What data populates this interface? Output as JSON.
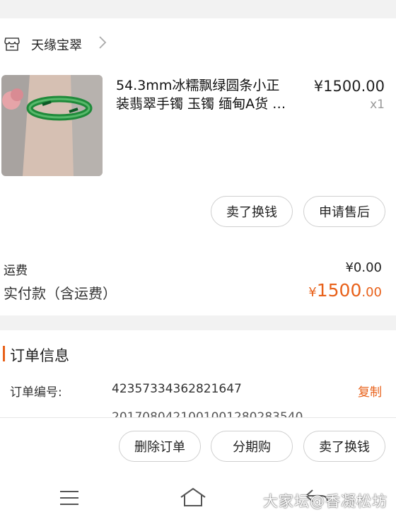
{
  "shop": {
    "name": "天缘宝翠",
    "store_icon": "store-icon",
    "chevron_icon": "chevron-right-icon"
  },
  "product": {
    "title_line1": "54.3mm冰糯飘绿圆条小正",
    "title_line2": "装翡翠手镯 玉镯 缅甸A货 …",
    "price": "¥1500.00",
    "quantity": "x1"
  },
  "item_actions": {
    "sell": "卖了换钱",
    "after_sale": "申请售后"
  },
  "summary": {
    "shipping_label": "运费",
    "shipping_value": "¥0.00",
    "paid_label": "实付款（含运费）",
    "paid_currency": "¥",
    "paid_integer": "1500",
    "paid_decimal": ".00"
  },
  "order_info": {
    "title": "订单信息",
    "number_label": "订单编号:",
    "number_value": "4235733436282164​7",
    "copy_label": "复制",
    "second_value": "2017080421001001280283540"
  },
  "bottom_actions": {
    "delete": "删除订单",
    "installment": "分期购",
    "sell": "卖了换钱"
  },
  "nav": {
    "menu_icon": "menu-icon",
    "home_icon": "home-icon",
    "back_icon": "back-icon",
    "watermark": "大家坛@香凝松坊"
  },
  "colors": {
    "accent": "#e8611a",
    "background": "#f2f2f2"
  }
}
